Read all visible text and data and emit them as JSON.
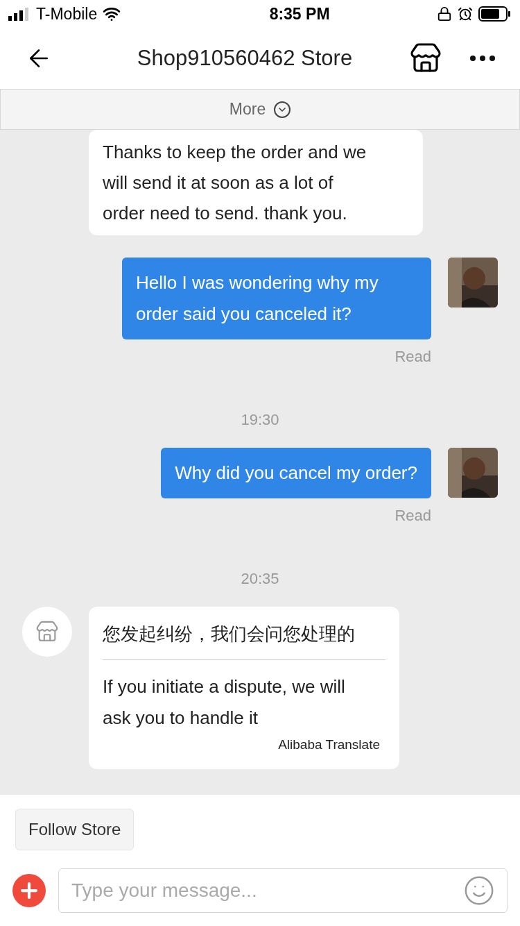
{
  "status_bar": {
    "carrier": "T-Mobile",
    "time": "8:35 PM"
  },
  "header": {
    "title": "Shop910560462 Store"
  },
  "more_bar": {
    "label": "More"
  },
  "messages": [
    {
      "kind": "incoming",
      "text": "Thanks to keep the order and we will send it at soon as a lot of order need to send. thank you."
    },
    {
      "kind": "outgoing",
      "text": "Hello I was wondering why my order said you canceled it?",
      "receipt": "Read"
    },
    {
      "kind": "timestamp",
      "text": "19:30"
    },
    {
      "kind": "outgoing",
      "text": "Why did you cancel my order?",
      "receipt": "Read"
    },
    {
      "kind": "timestamp",
      "text": "20:35"
    },
    {
      "kind": "translated",
      "original": "您发起纠纷，我们会问您处理的",
      "translation": "If you initiate a dispute, we will ask you to handle it",
      "source": "Alibaba Translate"
    }
  ],
  "follow_button": "Follow Store",
  "composer": {
    "placeholder": "Type your message..."
  }
}
